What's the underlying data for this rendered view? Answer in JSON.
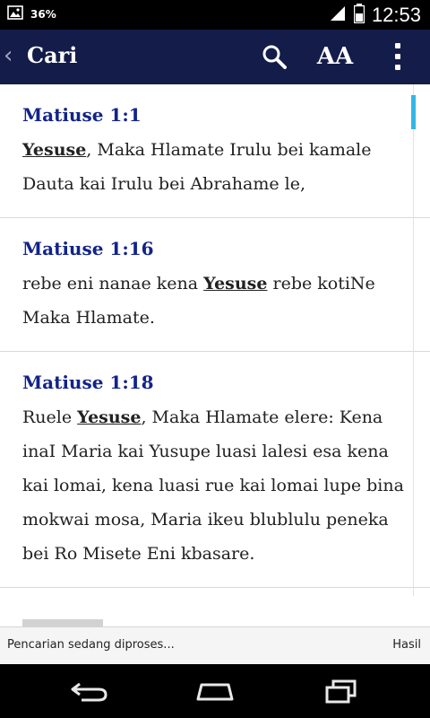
{
  "status_bar": {
    "battery_percent": "36%",
    "time": "12:53",
    "icons": [
      "image-notification-icon",
      "battery-percent-icon",
      "signal-icon",
      "battery-icon"
    ]
  },
  "app_bar": {
    "title": "Cari",
    "text_size_label": "AA",
    "icons": [
      "back-chevron-icon",
      "search-icon",
      "text-size-icon",
      "overflow-menu-icon"
    ]
  },
  "results": [
    {
      "reference": "Matiuse 1:1",
      "verse_parts": [
        "",
        "Yesuse",
        ", Maka Hlamate Irulu bei kamale Dauta kai Irulu bei Abrahame le,"
      ]
    },
    {
      "reference": "Matiuse 1:16",
      "verse_parts": [
        "rebe eni nanae kena ",
        "Yesuse",
        " rebe kotiNe Maka Hlamate."
      ]
    },
    {
      "reference": "Matiuse 1:18",
      "verse_parts": [
        "Ruele ",
        "Yesuse",
        ", Maka Hlamate elere: Kena inaI Maria kai Yusupe luasi lalesi esa kena kai lomai, kena luasi rue kai lomai lupe bina mokwai mosa, Maria ikeu blublulu peneka bei Ro Misete Eni kbasare."
      ]
    }
  ],
  "footer": {
    "status_text": "Pencarian sedang diproses...",
    "results_label": "Hasil"
  },
  "nav_bar": {
    "icons": [
      "back-icon",
      "home-icon",
      "recent-apps-icon"
    ]
  },
  "colors": {
    "app_bar_bg": "#141c49",
    "reference_text": "#12238a",
    "scroll_indicator": "#33b5e5"
  }
}
